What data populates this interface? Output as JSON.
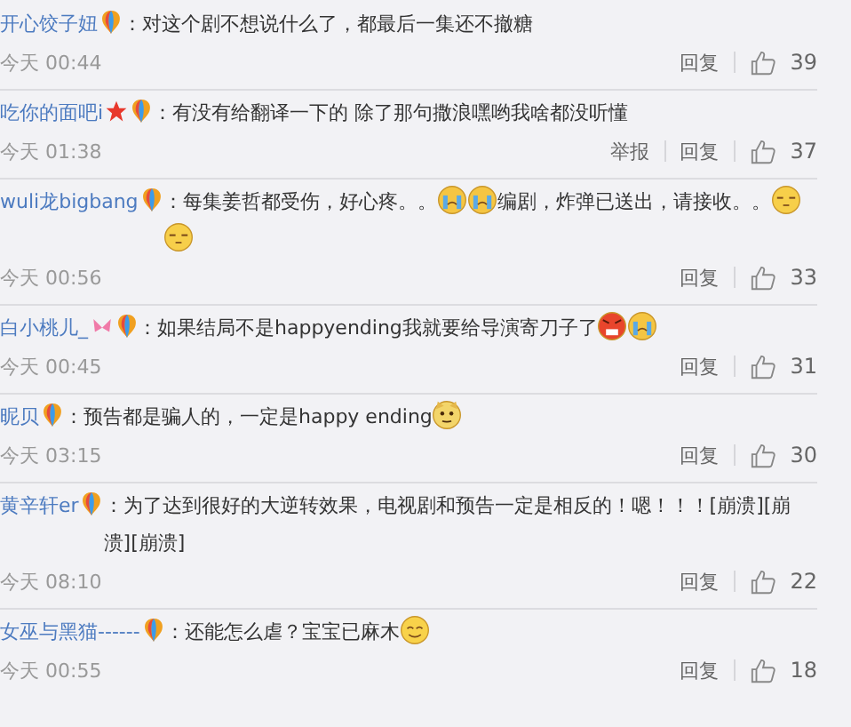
{
  "comments": [
    {
      "user": "开心饺子妞",
      "badges": [
        {
          "kind": "balloon"
        }
      ],
      "parts": [
        {
          "kind": "text",
          "text": "：对这个剧不想说什么了，都最后一集还不撤糖"
        }
      ],
      "time": "今天 00:44",
      "reply": "回复",
      "likes": "39"
    },
    {
      "user": "吃你的面吧i",
      "badges": [
        {
          "kind": "star"
        },
        {
          "kind": "balloon"
        }
      ],
      "parts": [
        {
          "kind": "text",
          "text": "：有没有给翻译一下的 除了那句撒浪嘿哟我啥都没听懂"
        }
      ],
      "time": "今天 01:38",
      "report": "举报",
      "reply": "回复",
      "likes": "37"
    },
    {
      "user": "wuli龙bigbang",
      "badges": [
        {
          "kind": "balloon"
        }
      ],
      "parts": [
        {
          "kind": "text",
          "text": "：每集姜哲都受伤，好心疼。。"
        },
        {
          "kind": "cry"
        },
        {
          "kind": "cry"
        },
        {
          "kind": "text",
          "text": "编剧，炸弹已送出，请接收。。"
        },
        {
          "kind": "speechless"
        },
        {
          "kind": "speechless"
        }
      ],
      "time": "今天 00:56",
      "reply": "回复",
      "likes": "33"
    },
    {
      "user": "白小桃儿_",
      "badges": [
        {
          "kind": "bunny"
        },
        {
          "kind": "balloon"
        }
      ],
      "parts": [
        {
          "kind": "text",
          "text": "：如果结局不是happyending我就要给导演寄刀子了"
        },
        {
          "kind": "angry"
        },
        {
          "kind": "cry"
        }
      ],
      "time": "今天 00:45",
      "reply": "回复",
      "likes": "31"
    },
    {
      "user": "昵贝",
      "badges": [
        {
          "kind": "balloon"
        }
      ],
      "parts": [
        {
          "kind": "text",
          "text": "：预告都是骗人的，一定是happy ending"
        },
        {
          "kind": "dog"
        }
      ],
      "time": "今天 03:15",
      "reply": "回复",
      "likes": "30"
    },
    {
      "user": "黄辛轩er",
      "badges": [
        {
          "kind": "balloon"
        }
      ],
      "parts": [
        {
          "kind": "text",
          "text": "：为了达到很好的大逆转效果，电视剧和预告一定是相反的！嗯！！！[崩溃][崩溃][崩溃]"
        }
      ],
      "time": "今天 08:10",
      "reply": "回复",
      "likes": "22"
    },
    {
      "user": "女巫与黑猫------",
      "badges": [
        {
          "kind": "balloon"
        }
      ],
      "parts": [
        {
          "kind": "text",
          "text": "：还能怎么虐？宝宝已麻木"
        },
        {
          "kind": "smile"
        }
      ],
      "time": "今天 00:55",
      "reply": "回复",
      "likes": "18"
    }
  ]
}
